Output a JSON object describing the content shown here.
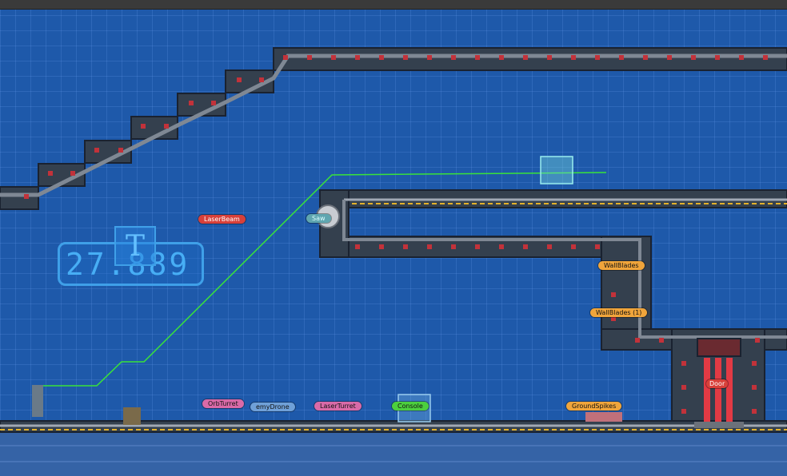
{
  "window": {
    "top_bar": ""
  },
  "hud": {
    "timer": "27.889",
    "timer_icon_letter": "T"
  },
  "object_labels": [
    {
      "id": "laser-beam",
      "text": "LaserBeam",
      "color": "red"
    },
    {
      "id": "saw",
      "text": "Saw",
      "color": "teal"
    },
    {
      "id": "wall-blades",
      "text": "WallBlades",
      "color": "orange"
    },
    {
      "id": "wall-blades-1",
      "text": "WallBlades (1)",
      "color": "orange"
    },
    {
      "id": "door",
      "text": "Door",
      "color": "red"
    },
    {
      "id": "orb-turret",
      "text": "OrbTurret",
      "color": "pink"
    },
    {
      "id": "enemy-drone",
      "text": "emyDrone",
      "color": "blue"
    },
    {
      "id": "laser-turret",
      "text": "LaserTurret",
      "color": "pink"
    },
    {
      "id": "console",
      "text": "Console",
      "color": "green"
    },
    {
      "id": "ground-spikes",
      "text": "GroundSpikes",
      "color": "orange"
    }
  ],
  "colors": {
    "background": "#1e59aa",
    "path_line": "#39e339",
    "pipe": "#5b6470",
    "rivet": "#c2323a"
  }
}
